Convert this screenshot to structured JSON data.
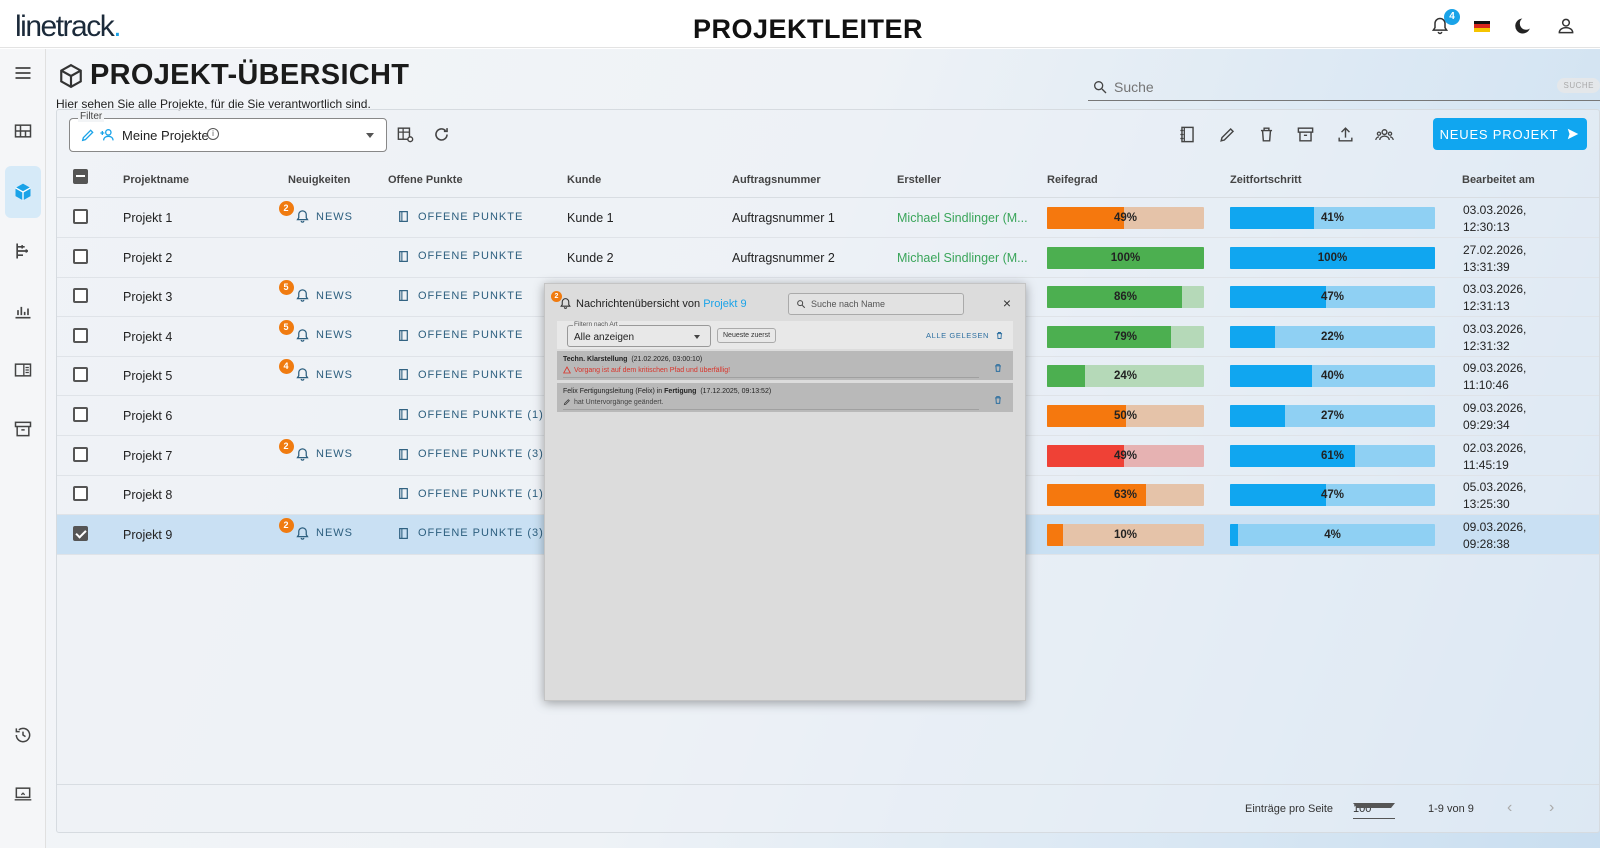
{
  "app": {
    "logo_text": "linetrack",
    "logo_dot": ".",
    "role": "PROJEKTLEITER",
    "notification_count": "4",
    "colors": {
      "accent": "#10a6f0",
      "orange": "#f07b10",
      "green": "#3aa55a"
    }
  },
  "page": {
    "title": "PROJEKT-ÜBERSICHT",
    "subtitle": "Hier sehen Sie alle Projekte, für die Sie verantwortlich sind.",
    "search_placeholder": "Suche",
    "search_tag": "SUCHE"
  },
  "toolbar": {
    "filter_legend": "Filter",
    "filter_value": "Meine Projekte",
    "info_symbol": "i",
    "new_project": "NEUES PROJEKT"
  },
  "columns": [
    "Projektname",
    "Neuigkeiten",
    "Offene Punkte",
    "Kunde",
    "Auftragsnummer",
    "Ersteller",
    "Reifegrad",
    "Zeitfortschritt",
    "Bearbeitet am"
  ],
  "rows": [
    {
      "name": "Projekt 1",
      "news_badge": "2",
      "news": "NEWS",
      "open": "OFFENE PUNKTE",
      "kunde": "Kunde 1",
      "auftrag": "Auftragsnummer 1",
      "ersteller": "Michael Sindlinger (M...",
      "reife": 49,
      "reife_label": "49%",
      "reife_color": "orange",
      "zeit": 41,
      "zeit_label": "41%",
      "date1": "03.03.2026,",
      "date2": "12:30:13",
      "checked": false
    },
    {
      "name": "Projekt 2",
      "news_badge": "",
      "news": "",
      "open": "OFFENE PUNKTE",
      "kunde": "Kunde 2",
      "auftrag": "Auftragsnummer 2",
      "ersteller": "Michael Sindlinger (M...",
      "reife": 100,
      "reife_label": "100%",
      "reife_color": "green",
      "zeit": 100,
      "zeit_label": "100%",
      "date1": "27.02.2026,",
      "date2": "13:31:39",
      "checked": false
    },
    {
      "name": "Projekt 3",
      "news_badge": "5",
      "news": "NEWS",
      "open": "OFFENE PUNKTE",
      "kunde": "",
      "auftrag": "",
      "ersteller": "",
      "reife": 86,
      "reife_label": "86%",
      "reife_color": "green",
      "zeit": 47,
      "zeit_label": "47%",
      "date1": "03.03.2026,",
      "date2": "12:31:13",
      "checked": false
    },
    {
      "name": "Projekt 4",
      "news_badge": "5",
      "news": "NEWS",
      "open": "OFFENE PUNKTE",
      "kunde": "",
      "auftrag": "",
      "ersteller": "",
      "reife": 79,
      "reife_label": "79%",
      "reife_color": "green",
      "zeit": 22,
      "zeit_label": "22%",
      "date1": "03.03.2026,",
      "date2": "12:31:32",
      "checked": false
    },
    {
      "name": "Projekt 5",
      "news_badge": "4",
      "news": "NEWS",
      "open": "OFFENE PUNKTE",
      "kunde": "",
      "auftrag": "",
      "ersteller": "",
      "reife": 24,
      "reife_label": "24%",
      "reife_color": "green",
      "zeit": 40,
      "zeit_label": "40%",
      "date1": "09.03.2026,",
      "date2": "11:10:46",
      "checked": false
    },
    {
      "name": "Projekt 6",
      "news_badge": "",
      "news": "",
      "open": "OFFENE PUNKTE (1)",
      "kunde": "",
      "auftrag": "",
      "ersteller": "",
      "reife": 50,
      "reife_label": "50%",
      "reife_color": "orange",
      "zeit": 27,
      "zeit_label": "27%",
      "date1": "09.03.2026,",
      "date2": "09:29:34",
      "checked": false
    },
    {
      "name": "Projekt 7",
      "news_badge": "2",
      "news": "NEWS",
      "open": "OFFENE PUNKTE (3)",
      "kunde": "",
      "auftrag": "",
      "ersteller": "",
      "reife": 49,
      "reife_label": "49%",
      "reife_color": "red",
      "zeit": 61,
      "zeit_label": "61%",
      "date1": "02.03.2026,",
      "date2": "11:45:19",
      "checked": false
    },
    {
      "name": "Projekt 8",
      "news_badge": "",
      "news": "",
      "open": "OFFENE PUNKTE (1)",
      "kunde": "",
      "auftrag": "",
      "ersteller": "",
      "reife": 63,
      "reife_label": "63%",
      "reife_color": "orange",
      "zeit": 47,
      "zeit_label": "47%",
      "date1": "05.03.2026,",
      "date2": "13:25:30",
      "checked": false
    },
    {
      "name": "Projekt 9",
      "news_badge": "2",
      "news": "NEWS",
      "open": "OFFENE PUNKTE (3)",
      "kunde": "",
      "auftrag": "",
      "ersteller": "",
      "reife": 10,
      "reife_label": "10%",
      "reife_color": "orange",
      "zeit": 4,
      "zeit_label": "4%",
      "date1": "09.03.2026,",
      "date2": "09:28:38",
      "checked": true
    }
  ],
  "footer": {
    "per_page_label": "Einträge pro Seite",
    "per_page_value": "100",
    "range": "1-9 von 9",
    "prev": "‹",
    "next": "›"
  },
  "modal": {
    "badge": "2",
    "title_prefix": "Nachrichtenübersicht von ",
    "title_project": "Projekt 9",
    "search_placeholder": "Suche nach Name",
    "close": "×",
    "filter_legend": "Filtern nach Art",
    "filter_value": "Alle anzeigen",
    "sort_label": "Neueste zuerst",
    "all_read": "ALLE GELESEN",
    "items": [
      {
        "bold": "Techn. Klarstellung",
        "meta": "(21.02.2026, 03:00:10)",
        "text": "Vorgang ist auf dem kritischen Pfad und überfällig!",
        "kind": "red"
      },
      {
        "prefix": "Felix Fertigungsleitung (Felix) in ",
        "bold": "Fertigung",
        "meta": "(17.12.2025, 09:13:52)",
        "text": "hat Untervorgänge geändert.",
        "kind": "grey"
      }
    ]
  }
}
